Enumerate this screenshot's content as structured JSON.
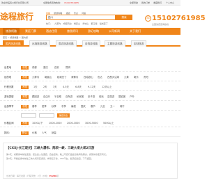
{
  "topbar": {
    "left_text": "欢迎光临四川旅行社有限公司",
    "mid_text": "全国免费咨询热线：",
    "hotline": "15102761985",
    "right_items": [
      "全部导航",
      "我的订单",
      "收藏我们",
      "个人中心"
    ]
  },
  "header": {
    "logo": "途程旅行",
    "search_tabs": [
      "线路",
      "旅游攻略",
      "酒店",
      "景点",
      "问答"
    ],
    "search_value": "四川",
    "search_button": "搜索",
    "hotwords": [
      "热门：",
      "九寨沟",
      "成都周边",
      "峨眉山",
      "青城山",
      "都江堰",
      "稻城亚丁"
    ],
    "phone": "15102761985",
    "phone_label": "全国免费咨询热线"
  },
  "nav": {
    "items": [
      "旅游线路",
      "景区门票",
      "酒店住宿",
      "旅游资讯",
      "游记攻略",
      "公司新闻",
      "关于我们"
    ],
    "active": 0
  },
  "breadcrumb": "首页 > 旅游线路 > 国内游",
  "tabs": {
    "items": [
      "国内旅游线路",
      "出境旅游线路",
      "周边旅游线路",
      "自驾游线路",
      "主题旅游线路",
      "定制旅游"
    ],
    "active": 0
  },
  "filters": {
    "rows": [
      {
        "label": "出发地",
        "options": [
          "不限",
          "成都",
          "重庆",
          "西安",
          "昆明"
        ]
      },
      {
        "label": "目的地",
        "options": [
          "不限",
          "九寨沟",
          "峨眉山",
          "稻城亚丁",
          "海螺沟",
          "四姑娘山",
          "色达",
          "西昌泸沽湖",
          "九黄",
          "峨乐",
          "贵阳"
        ]
      },
      {
        "label": "行程天数",
        "options": [
          "不限",
          "1天",
          "2天",
          "3天",
          "4-5天",
          "6-8天",
          "9-12天",
          "12天以上"
        ]
      },
      {
        "label": "游玩类型",
        "options": [
          "不限",
          "跟团游",
          "自由行",
          "半自助",
          "自驾游",
          "私家团",
          "亲子游",
          "纯玩",
          "高端游",
          "摄影团",
          "户外"
        ]
      },
      {
        "label": "出游季节",
        "options": [
          "不限",
          "春季",
          "夏季",
          "秋季",
          "冬季",
          "暑假",
          "国庆",
          "春节",
          "元旦",
          "五一",
          "端午"
        ]
      },
      {
        "label": "价格区间",
        "options": [
          "不限",
          "1000以下",
          "1000-2000",
          "2000-3000",
          "3000-5000",
          "5000以上"
        ]
      }
    ],
    "price_confirm": "确定筛选",
    "sort_label": "排序：",
    "sort_options": [
      "默认",
      "价格",
      "人气",
      "销量"
    ]
  },
  "result": {
    "title": "【CXXJ-长江观光】三峡大瀑布、两坝一峡、三峡大坝大坝2日游",
    "desc1": "第1天：成都乘车前往宜昌，抵达后入住酒店，自由活动，晚上可自行品尝当地特色美食，感受城市夜景风光。",
    "desc2": "第2天：早餐后乘车前往三峡大坝景区游览，参观坛子岭、185平台、截流纪念园，下午返回。",
    "meta_prefix": "出发日期：每天发团 | 行程天数：2天 | 价格：",
    "price": "¥1280",
    "price_suffix": "起"
  }
}
